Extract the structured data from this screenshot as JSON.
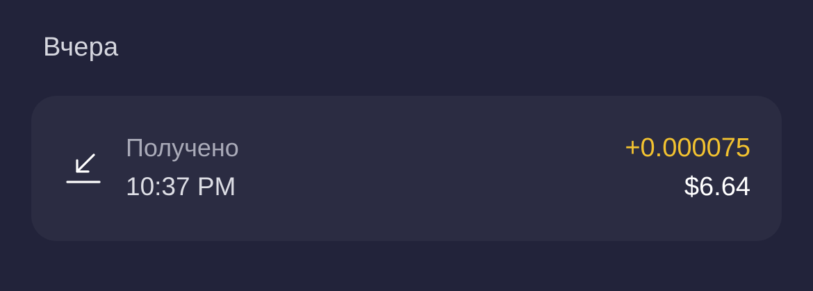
{
  "section": {
    "title": "Вчера"
  },
  "transaction": {
    "icon": "arrow-down-left-to-line-icon",
    "type": "Получено",
    "time": "10:37 PM",
    "crypto_amount": "+0.000075",
    "fiat_amount": "$6.64"
  },
  "colors": {
    "background": "#22233a",
    "card": "#2b2c42",
    "accent_amount": "#f2c230",
    "primary_text": "#ffffff",
    "secondary_text": "#a9aab8"
  }
}
